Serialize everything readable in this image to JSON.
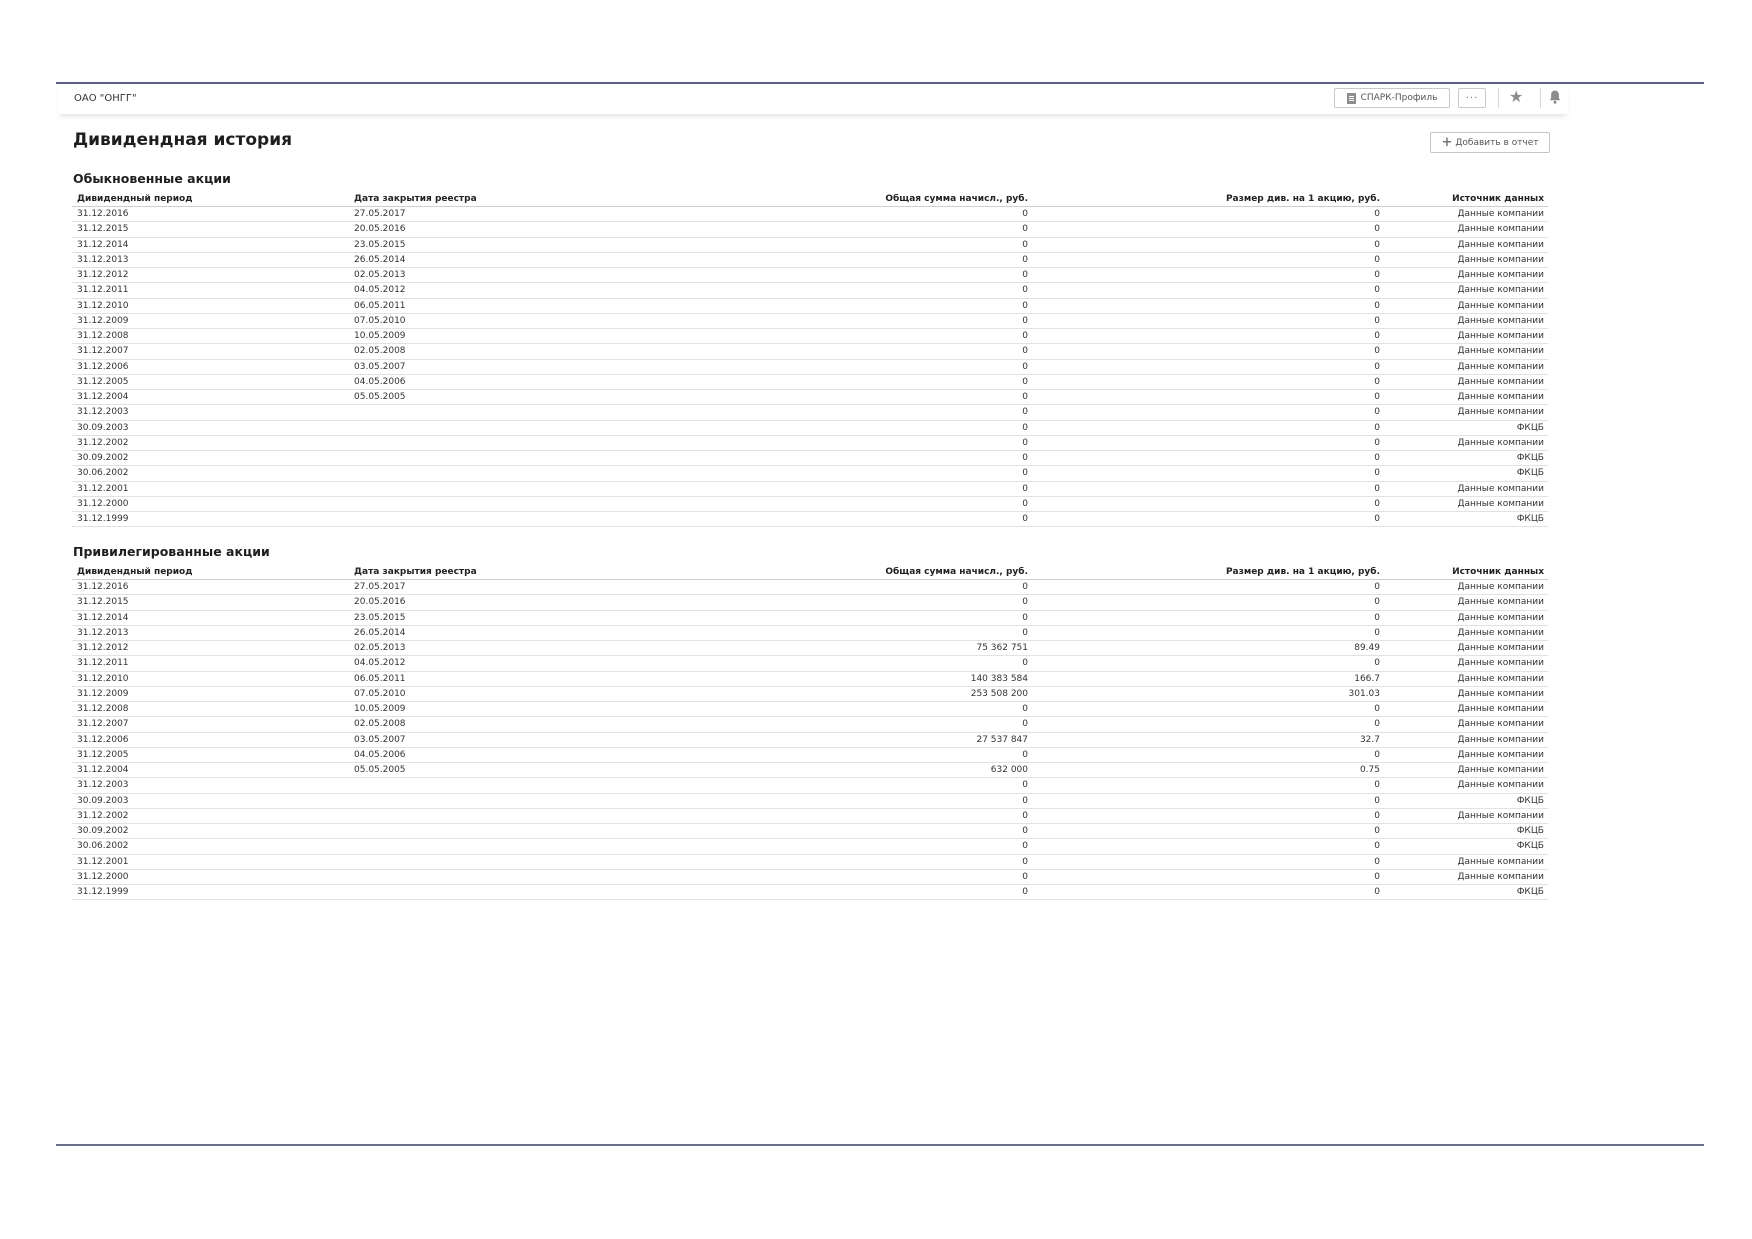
{
  "header": {
    "company_name": "ОАО \"ОНГГ\"",
    "spark_profile_label": "СПАРК-Профиль",
    "more_label": "···",
    "icons": [
      "document-icon",
      "more-icon",
      "star-icon",
      "bell-icon"
    ]
  },
  "page": {
    "title": "Дивидендная история",
    "add_to_report_label": "Добавить в отчет"
  },
  "columns": [
    "Дивидендный период",
    "Дата закрытия реестра",
    "Общая сумма начисл., руб.",
    "Размер див. на 1 акцию, руб.",
    "Источник данных"
  ],
  "ordinary": {
    "title": "Обыкновенные акции",
    "rows": [
      [
        "31.12.2016",
        "27.05.2017",
        "0",
        "0",
        "Данные компании"
      ],
      [
        "31.12.2015",
        "20.05.2016",
        "0",
        "0",
        "Данные компании"
      ],
      [
        "31.12.2014",
        "23.05.2015",
        "0",
        "0",
        "Данные компании"
      ],
      [
        "31.12.2013",
        "26.05.2014",
        "0",
        "0",
        "Данные компании"
      ],
      [
        "31.12.2012",
        "02.05.2013",
        "0",
        "0",
        "Данные компании"
      ],
      [
        "31.12.2011",
        "04.05.2012",
        "0",
        "0",
        "Данные компании"
      ],
      [
        "31.12.2010",
        "06.05.2011",
        "0",
        "0",
        "Данные компании"
      ],
      [
        "31.12.2009",
        "07.05.2010",
        "0",
        "0",
        "Данные компании"
      ],
      [
        "31.12.2008",
        "10.05.2009",
        "0",
        "0",
        "Данные компании"
      ],
      [
        "31.12.2007",
        "02.05.2008",
        "0",
        "0",
        "Данные компании"
      ],
      [
        "31.12.2006",
        "03.05.2007",
        "0",
        "0",
        "Данные компании"
      ],
      [
        "31.12.2005",
        "04.05.2006",
        "0",
        "0",
        "Данные компании"
      ],
      [
        "31.12.2004",
        "05.05.2005",
        "0",
        "0",
        "Данные компании"
      ],
      [
        "31.12.2003",
        "",
        "0",
        "0",
        "Данные компании"
      ],
      [
        "30.09.2003",
        "",
        "0",
        "0",
        "ФКЦБ"
      ],
      [
        "31.12.2002",
        "",
        "0",
        "0",
        "Данные компании"
      ],
      [
        "30.09.2002",
        "",
        "0",
        "0",
        "ФКЦБ"
      ],
      [
        "30.06.2002",
        "",
        "0",
        "0",
        "ФКЦБ"
      ],
      [
        "31.12.2001",
        "",
        "0",
        "0",
        "Данные компании"
      ],
      [
        "31.12.2000",
        "",
        "0",
        "0",
        "Данные компании"
      ],
      [
        "31.12.1999",
        "",
        "0",
        "0",
        "ФКЦБ"
      ]
    ]
  },
  "preferred": {
    "title": "Привилегированные акции",
    "rows": [
      [
        "31.12.2016",
        "27.05.2017",
        "0",
        "0",
        "Данные компании"
      ],
      [
        "31.12.2015",
        "20.05.2016",
        "0",
        "0",
        "Данные компании"
      ],
      [
        "31.12.2014",
        "23.05.2015",
        "0",
        "0",
        "Данные компании"
      ],
      [
        "31.12.2013",
        "26.05.2014",
        "0",
        "0",
        "Данные компании"
      ],
      [
        "31.12.2012",
        "02.05.2013",
        "75 362 751",
        "89.49",
        "Данные компании"
      ],
      [
        "31.12.2011",
        "04.05.2012",
        "0",
        "0",
        "Данные компании"
      ],
      [
        "31.12.2010",
        "06.05.2011",
        "140 383 584",
        "166.7",
        "Данные компании"
      ],
      [
        "31.12.2009",
        "07.05.2010",
        "253 508 200",
        "301.03",
        "Данные компании"
      ],
      [
        "31.12.2008",
        "10.05.2009",
        "0",
        "0",
        "Данные компании"
      ],
      [
        "31.12.2007",
        "02.05.2008",
        "0",
        "0",
        "Данные компании"
      ],
      [
        "31.12.2006",
        "03.05.2007",
        "27 537 847",
        "32.7",
        "Данные компании"
      ],
      [
        "31.12.2005",
        "04.05.2006",
        "0",
        "0",
        "Данные компании"
      ],
      [
        "31.12.2004",
        "05.05.2005",
        "632 000",
        "0.75",
        "Данные компании"
      ],
      [
        "31.12.2003",
        "",
        "0",
        "0",
        "Данные компании"
      ],
      [
        "30.09.2003",
        "",
        "0",
        "0",
        "ФКЦБ"
      ],
      [
        "31.12.2002",
        "",
        "0",
        "0",
        "Данные компании"
      ],
      [
        "30.09.2002",
        "",
        "0",
        "0",
        "ФКЦБ"
      ],
      [
        "30.06.2002",
        "",
        "0",
        "0",
        "ФКЦБ"
      ],
      [
        "31.12.2001",
        "",
        "0",
        "0",
        "Данные компании"
      ],
      [
        "31.12.2000",
        "",
        "0",
        "0",
        "Данные компании"
      ],
      [
        "31.12.1999",
        "",
        "0",
        "0",
        "ФКЦБ"
      ]
    ]
  }
}
